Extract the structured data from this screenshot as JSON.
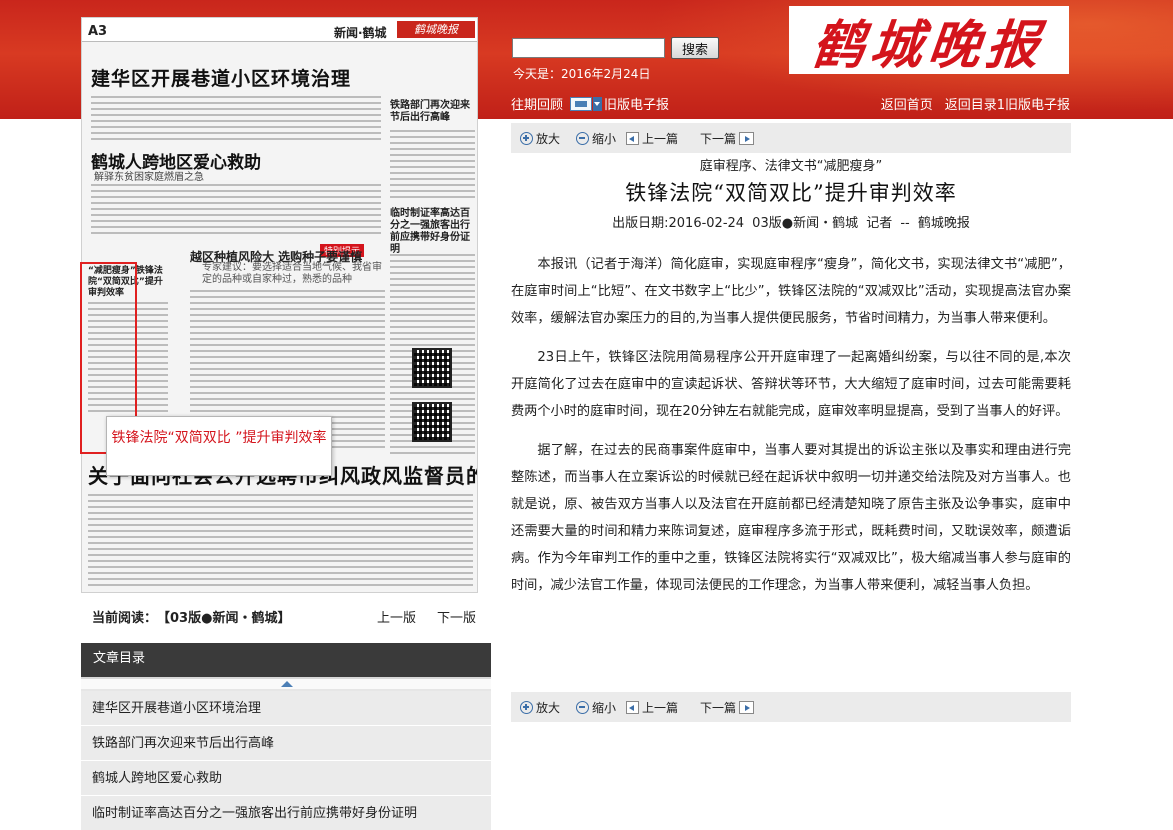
{
  "header": {
    "logo_text": "鹤城晚报",
    "search_placeholder": "",
    "search_button": "搜索",
    "today": "今天是：2016年2月24日",
    "past_issues": "往期回顾",
    "old_edition": "旧版电子报",
    "back_home": "返回首页",
    "back_old_list": "返回目录1旧版电子报"
  },
  "paper_thumb": {
    "page": "A3",
    "section": "新闻·鹤城",
    "mini_logo": "鹤城晚报",
    "headline1": "建华区开展巷道小区环境治理",
    "headline2": "鹤城人跨地区爱心救助",
    "headline2_sub": "解驿东贫困家庭燃眉之急",
    "headline3": "越区种植风险大 选购种子要谨慎",
    "headline3_sub": "专家建议：要选择适合当地气候、我省审定的品种或自家种过，熟悉的品种",
    "side1": "铁路部门再次迎来节后出行高峰",
    "side2": "临时制证率高达百分之一强旅客出行前应携带好身份证明",
    "tag": "特别提示",
    "box": "“减肥瘦身”铁锋法院“双简双比”提升审判效率",
    "headline4": "关于面向社会公开选聘市纠风政风监督员的公告",
    "tooltip": "铁锋法院“双简双比 ”提升审判效率"
  },
  "current": {
    "label": "当前阅读：",
    "value": "【03版●新闻・鹤城】",
    "prev": "上一版",
    "next": "下一版"
  },
  "toc": {
    "title": "文章目录",
    "items": [
      "建华区开展巷道小区环境治理",
      "铁路部门再次迎来节后出行高峰",
      "鹤城人跨地区爱心救助",
      "临时制证率高达百分之一强旅客出行前应携带好身份证明"
    ]
  },
  "toolbar": {
    "zoom_in": "放大",
    "zoom_out": "缩小",
    "prev_article": "上一篇",
    "next_article": "下一篇"
  },
  "article": {
    "kicker": "庭审程序、法律文书“减肥瘦身”",
    "title": "铁锋法院“双简双比”提升审判效率",
    "meta": "出版日期:2016-02-24   03版●新闻・鹤城   记者 --   鹤城晚报",
    "paragraphs": [
      "本报讯（记者于海洋）简化庭审，实现庭审程序“瘦身”，简化文书，实现法律文书“减肥”，在庭审时间上“比短”、在文书数字上“比少”，铁锋区法院的“双减双比”活动，实现提高法官办案效率，缓解法官办案压力的目的,为当事人提供便民服务，节省时间精力，为当事人带来便利。",
      "23日上午，铁锋区法院用简易程序公开开庭审理了一起离婚纠纷案，与以往不同的是,本次开庭简化了过去在庭审中的宣读起诉状、答辩状等环节，大大缩短了庭审时间，过去可能需要耗费两个小时的庭审时间，现在20分钟左右就能完成，庭审效率明显提高，受到了当事人的好评。",
      "据了解，在过去的民商事案件庭审中，当事人要对其提出的诉讼主张以及事实和理由进行完整陈述，而当事人在立案诉讼的时候就已经在起诉状中叙明一切并递交给法院及对方当事人。也就是说，原、被告双方当事人以及法官在开庭前都已经清楚知晓了原告主张及讼争事实，庭审中还需要大量的时间和精力来陈词复述，庭审程序多流于形式，既耗费时间，又耽误效率，颇遭诟病。作为今年审判工作的重中之重，铁锋区法院将实行“双减双比”，极大缩减当事人参与庭审的时间，减少法官工作量，体现司法便民的工作理念，为当事人带来便利，减轻当事人负担。"
    ]
  }
}
